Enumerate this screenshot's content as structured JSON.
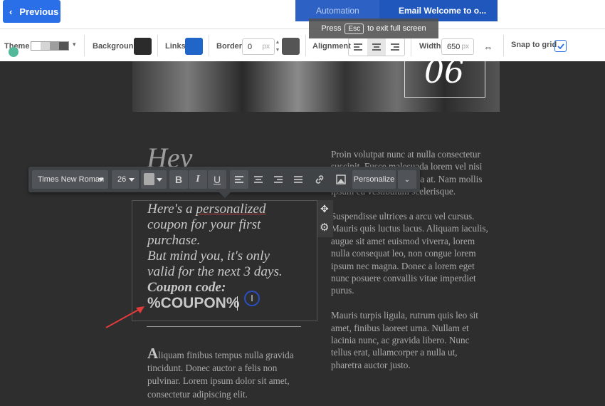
{
  "topbar": {
    "previous_label": "Previous",
    "steps": [
      "Automation",
      "Email Welcome to o..."
    ]
  },
  "toast": {
    "before": "Press",
    "key": "Esc",
    "after": "to exit full screen"
  },
  "toolbar": {
    "theme_label": "Theme",
    "background_label": "Background",
    "links_label": "Links",
    "border_label": "Border",
    "border_value": "0",
    "border_unit": "px",
    "alignment_label": "Alignment",
    "alignment_selected": "center",
    "width_label": "Width",
    "width_value": "650",
    "width_unit": "px",
    "snap_label": "Snap to grid",
    "snap_checked": true,
    "colors": {
      "background": "#2b2b2b",
      "links": "#1f66c8",
      "border": "#555555"
    }
  },
  "banner": {
    "number": "06"
  },
  "format_bar": {
    "font": "Times New Roman",
    "size": "26",
    "bold": "B",
    "italic": "I",
    "underline": "U",
    "personalize": "Personalize"
  },
  "content": {
    "heading": "Hey",
    "coupon_lines": [
      "Here's a personalized",
      "coupon for your first",
      "purchase.",
      "But mind you, it's only",
      "valid for the next 3 days.",
      "Coupon code:"
    ],
    "coupon_code": "%COUPON%",
    "left_para_cap": "A",
    "left_para": "liquam finibus tempus nulla gravida tincidunt. Donec auctor a felis non pulvinar. Lorem ipsum dolor sit amet, consectetur adipiscing elit.",
    "right_paras": [
      "Proin volutpat nunc at nulla consectetur suscipit. Fusce malesuada lorem vel nisi blandit, ac turpis gravida at. Nam mollis ipsum eu vestibulum scelerisque.",
      "Suspendisse ultrices a arcu vel cursus. Mauris quis luctus lacus. Aliquam iaculis, augue sit amet euismod viverra, lorem nulla consequat leo, non congue lorem ipsum nec magna. Donec a lorem eget nunc posuere convallis vitae imperdiet purus.",
      "Mauris turpis ligula, rutrum quis leo sit amet, finibus laoreet urna. Nullam et lacinia nunc, ac gravida libero. Nunc tellus erat, ullamcorper a nulla ut, pharetra auctor justo."
    ]
  }
}
